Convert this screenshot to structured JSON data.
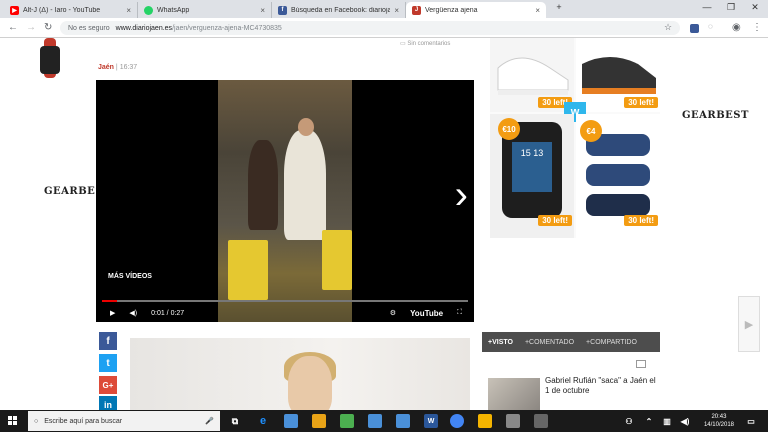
{
  "tabs": [
    {
      "label": "Alt-J (Δ) - Iaro - YouTube",
      "color": "#ff0000"
    },
    {
      "label": "WhatsApp",
      "color": "#25d366"
    },
    {
      "label": "Búsqueda en Facebook: diarioja...",
      "color": "#3b5998"
    },
    {
      "label": "Vergüenza ajena",
      "color": "#c0392b"
    }
  ],
  "addressbar": {
    "security": "No es seguro",
    "domain": "www.diariojaen.es",
    "path": "/jaen/verguenza-ajena-MC4730835"
  },
  "article": {
    "city": "Jaén",
    "time": "16:37",
    "comments": "Sin comentarios"
  },
  "video": {
    "more_videos": "MÁS VÍDEOS",
    "time": "0:01 / 0:27",
    "brand": "YouTube",
    "progress": 0.04
  },
  "ads": {
    "gearbest": "GEARBEST",
    "badges": [
      "30 left!",
      "30 left!",
      "30 left!",
      "30 left!"
    ],
    "prices": [
      "€10",
      "€4"
    ],
    "watch_time": "15 13"
  },
  "social": [
    "f",
    "t",
    "G+",
    "in"
  ],
  "widget": {
    "tabs": [
      "+VISTO",
      "+COMENTADO",
      "+COMPARTIDO"
    ],
    "headline": "Gabriel Rufián \"saca\" a Jaén el 1 de octubre"
  },
  "taskbar": {
    "search_placeholder": "Escribe aquí para buscar",
    "time": "20:43",
    "date": "14/10/2018"
  }
}
